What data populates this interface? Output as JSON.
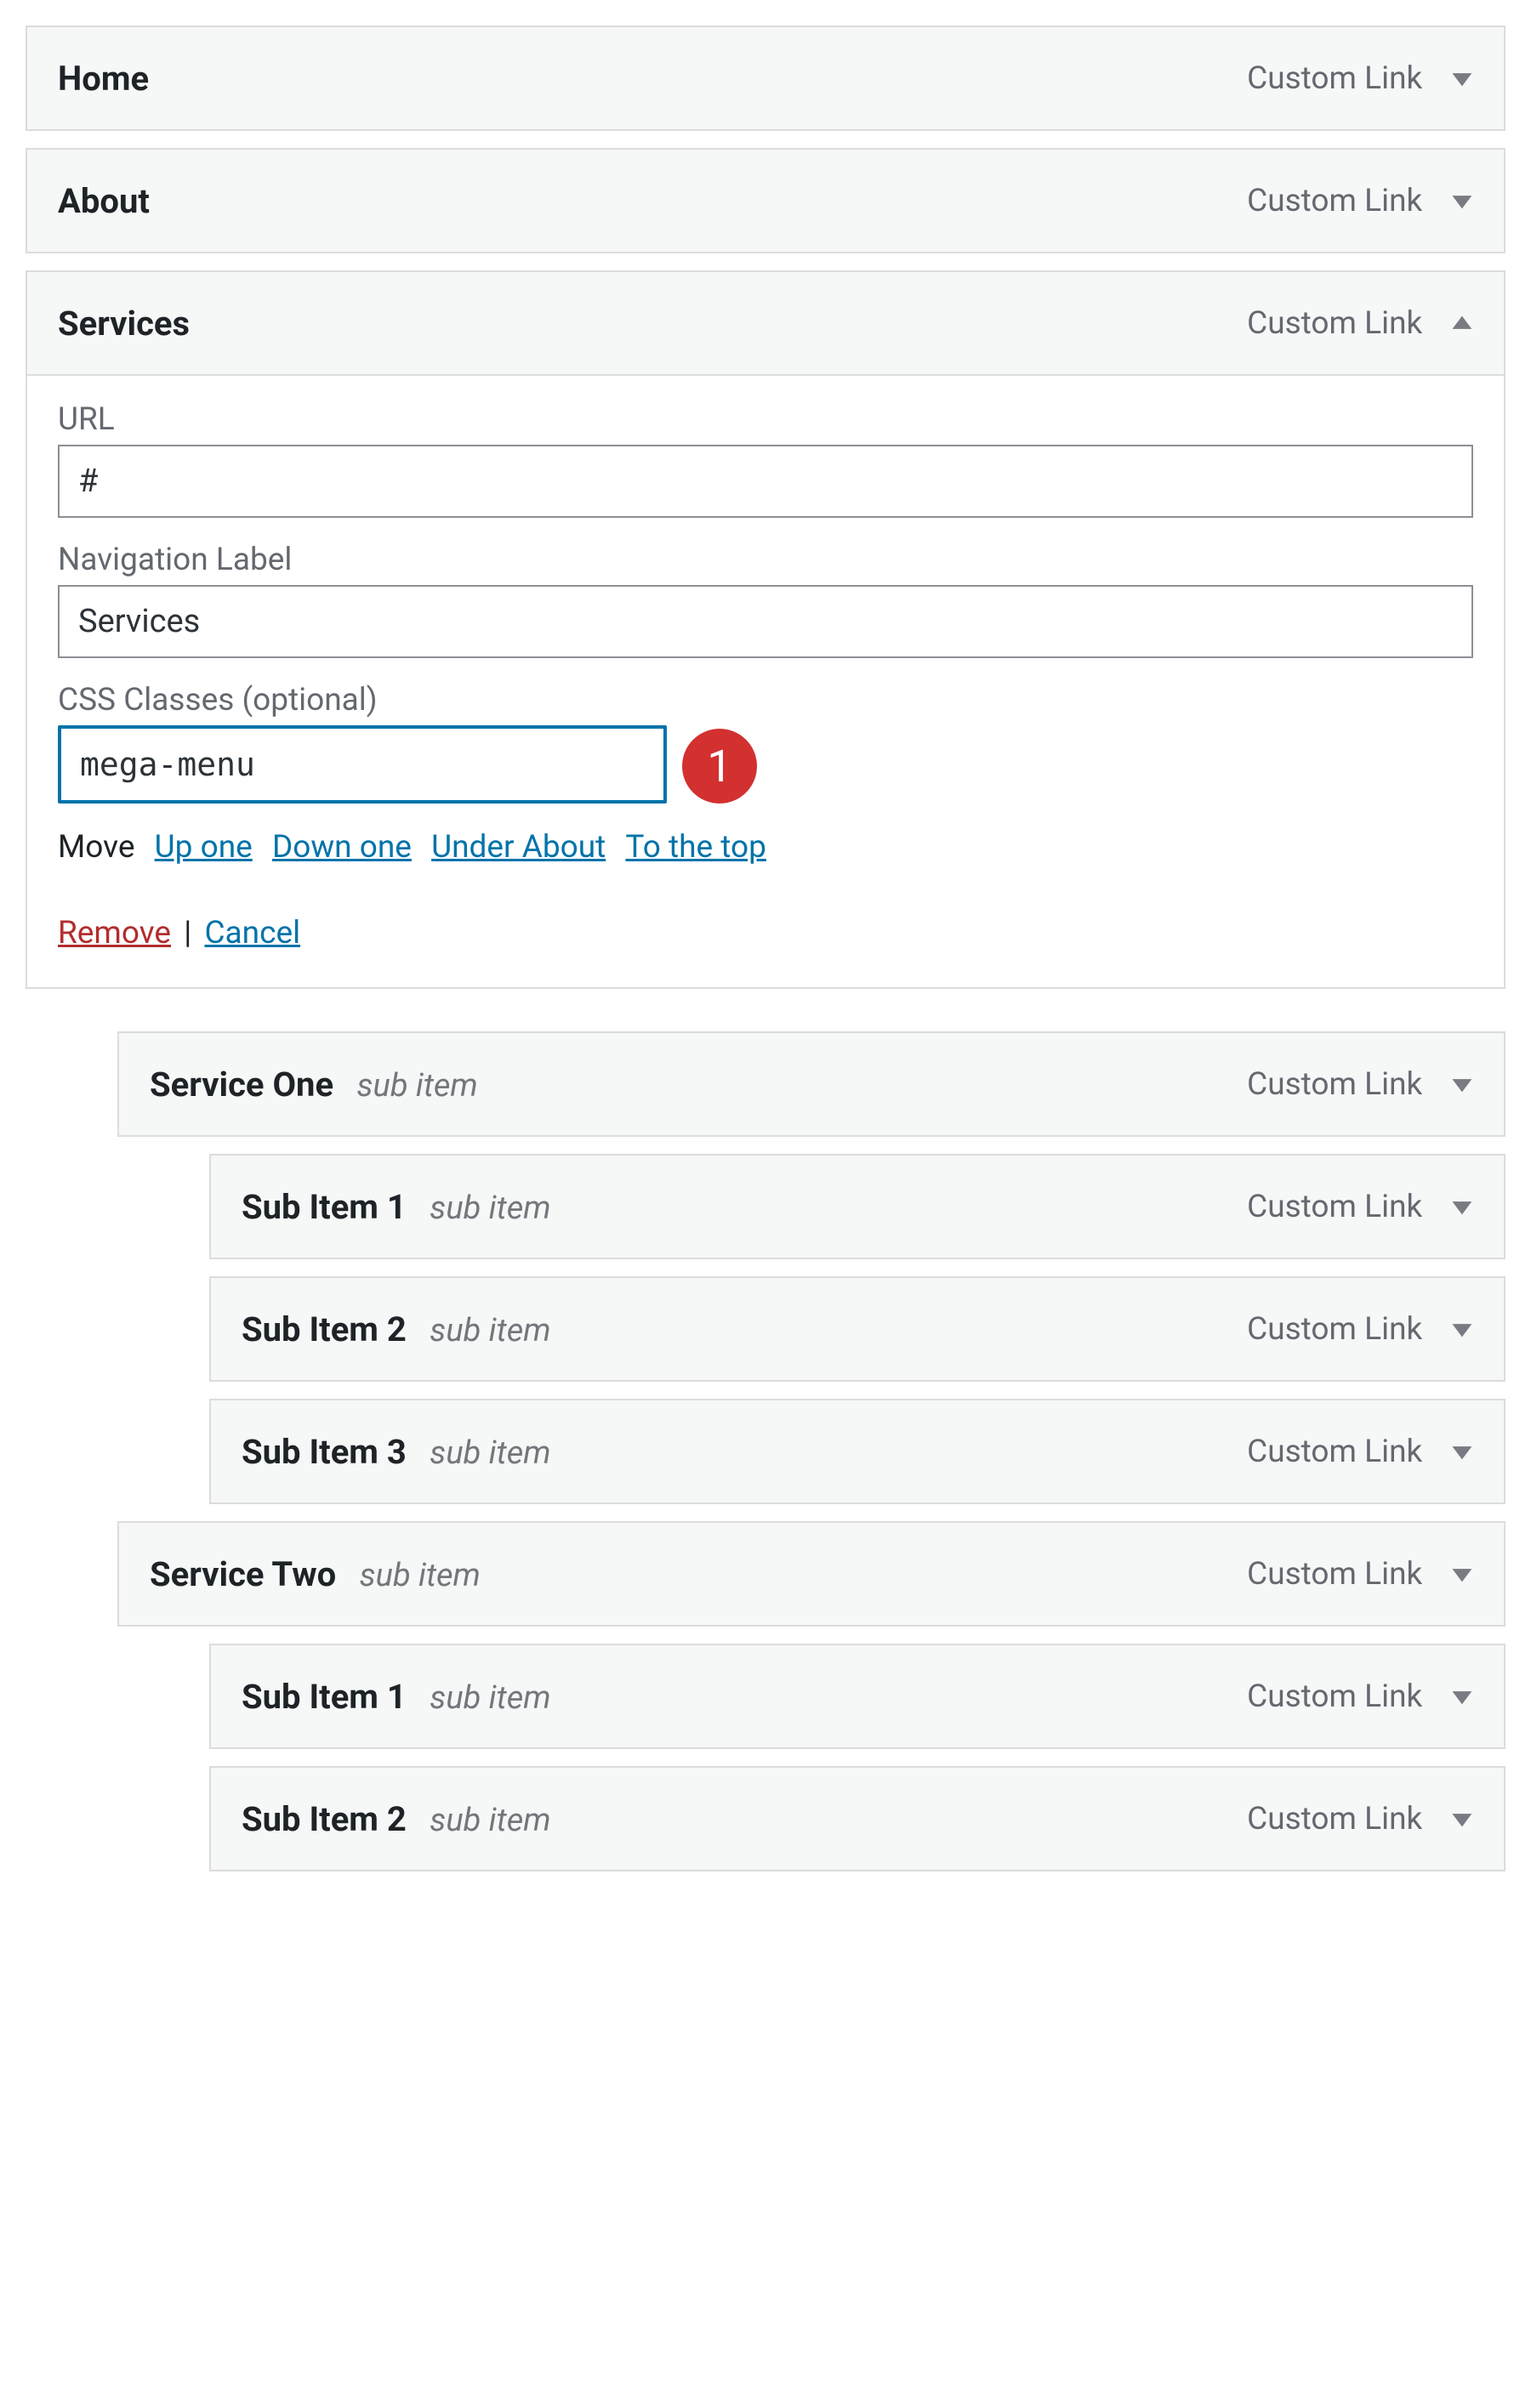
{
  "type_label": "Custom Link",
  "sub_label": "sub item",
  "items": {
    "home": {
      "title": "Home"
    },
    "about": {
      "title": "About"
    },
    "services": {
      "title": "Services"
    },
    "s1": {
      "title": "Service One"
    },
    "s1a": {
      "title": "Sub Item 1"
    },
    "s1b": {
      "title": "Sub Item 2"
    },
    "s1c": {
      "title": "Sub Item 3"
    },
    "s2": {
      "title": "Service Two"
    },
    "s2a": {
      "title": "Sub Item 1"
    },
    "s2b": {
      "title": "Sub Item 2"
    }
  },
  "details": {
    "url_label": "URL",
    "url_value": "#",
    "nav_label": "Navigation Label",
    "nav_value": "Services",
    "css_label": "CSS Classes (optional)",
    "css_value": "mega-menu",
    "annotation_number": "1",
    "move_label": "Move",
    "move_up": "Up one",
    "move_down": "Down one",
    "move_under": "Under About",
    "move_top": "To the top",
    "remove": "Remove",
    "cancel": "Cancel"
  }
}
